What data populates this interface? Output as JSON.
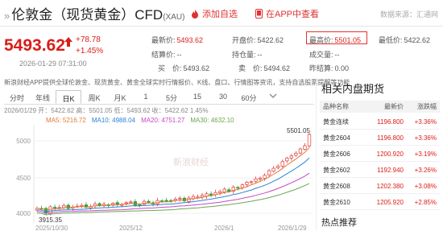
{
  "header": {
    "title": "伦敦金（现货黄金）CFD",
    "code": "(XAU)",
    "follow_label": "添加自选",
    "app_label": "在APP中查看",
    "source": "数据来源：汇通网"
  },
  "quote": {
    "price": "5493.62",
    "change": "+78.78",
    "change_pct": "+1.45%",
    "time": "2026-01-29 07:31:00",
    "fields": [
      {
        "label": "最新价:",
        "value": "5493.62"
      },
      {
        "label": "开盘价:",
        "value": "5422.62"
      },
      {
        "label": "最高价:",
        "value": "5501.05"
      },
      {
        "label": "最低价:",
        "value": "5422.62"
      },
      {
        "label": "结算价:",
        "value": "--"
      },
      {
        "label": "持仓量:",
        "value": "--"
      },
      {
        "label": "成交量:",
        "value": "--"
      },
      {
        "label": "买　价:",
        "value": "5493.62"
      },
      {
        "label": "卖　价:",
        "value": "5494.62"
      },
      {
        "label": "昨结算:",
        "value": "0.00"
      }
    ]
  },
  "notice": "新浪财经APP提供全球伦敦金、现货黄金、黄金全球实时行情报价、K线、盘口、行情图等资讯，支持自选股票提醒等功能",
  "tabs": [
    "分时",
    "年线",
    "日K",
    "周K",
    "月K",
    "1",
    "5分",
    "15",
    "30",
    "60分"
  ],
  "chart": {
    "header": "2026/01/29  开：5422.62  高：5501.05  低：5493.62  收：5422.62  1.45%",
    "ma": [
      {
        "label": "MA5: 5216.72",
        "color": "#e07b39"
      },
      {
        "label": "MA10: 4988.04",
        "color": "#2f83d6"
      },
      {
        "label": "MA20: 4751.27",
        "color": "#c848c8"
      },
      {
        "label": "MA30: 4632.10",
        "color": "#6aa84f"
      }
    ],
    "y_ticks": [
      "5000",
      "4500",
      "4000"
    ],
    "x_ticks": [
      "2025/10/30",
      "2025/12",
      "2026/1",
      "2026/1/29"
    ],
    "high_label": "5501.05",
    "low_label": "3915.35",
    "watermark": "新浪财经"
  },
  "related": {
    "title": "相关内盘期货",
    "headers": [
      "品种名称",
      "最新价",
      "涨跌幅"
    ],
    "rows": [
      {
        "name": "黄金连续",
        "price": "1196.800",
        "chg": "+3.36%"
      },
      {
        "name": "黄金2604",
        "price": "1196.800",
        "chg": "+3.36%"
      },
      {
        "name": "黄金2606",
        "price": "1200.920",
        "chg": "+3.19%"
      },
      {
        "name": "黄金2602",
        "price": "1192.940",
        "chg": "+3.26%"
      },
      {
        "name": "黄金2608",
        "price": "1202.380",
        "chg": "+3.08%"
      },
      {
        "name": "黄金2610",
        "price": "1205.920",
        "chg": "+2.85%"
      }
    ],
    "hot": "热点推荐"
  },
  "colors": {
    "up": "#d91e18",
    "accent": "#e03131"
  }
}
